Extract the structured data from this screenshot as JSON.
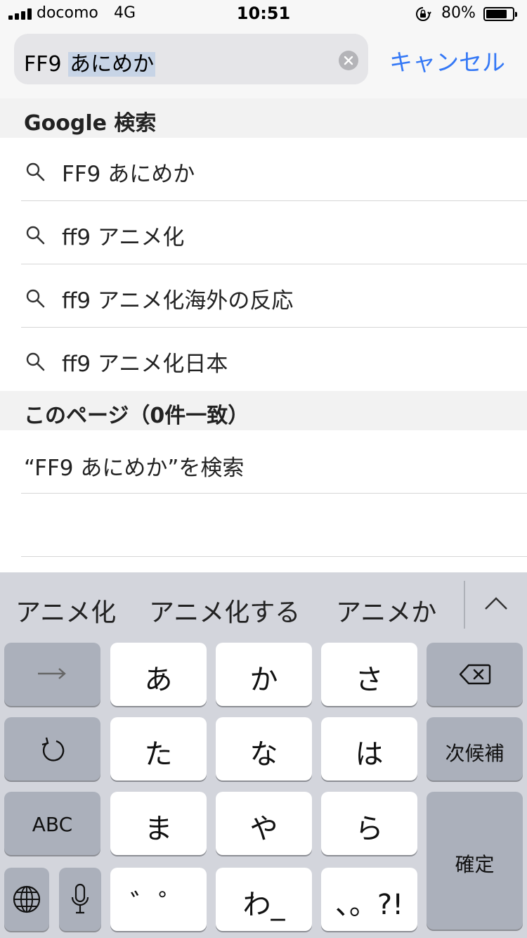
{
  "status_bar": {
    "carrier": "docomo",
    "network": "4G",
    "time": "10:51",
    "battery_percent": "80%",
    "battery_level": 0.8
  },
  "search": {
    "query_prefix": "FF9 ",
    "query_marked": "あにめか",
    "cancel_label": "キャンセル"
  },
  "google_section": {
    "title": "Google 検索",
    "suggestions": [
      "FF9 あにめか",
      "ff9 アニメ化",
      "ff9 アニメ化海外の反応",
      "ff9 アニメ化日本"
    ]
  },
  "page_section": {
    "title": "このページ（0件一致）",
    "find_label": "“FF9 あにめか”を検索"
  },
  "candidates": [
    "アニメ化",
    "アニメ化する",
    "アニメか"
  ],
  "keyboard": {
    "rows": [
      [
        "あ",
        "か",
        "さ"
      ],
      [
        "た",
        "な",
        "は"
      ],
      [
        "ま",
        "や",
        "ら"
      ],
      [
        "゛゜",
        "わ_",
        "、。?!"
      ]
    ],
    "next_candidate": "次候補",
    "abc": "ABC",
    "confirm": "確定"
  },
  "colors": {
    "accent": "#3478f6",
    "keyboard_bg": "#d3d5dc",
    "dark_key": "#abb0bb",
    "section_bg": "#f2f2f2"
  },
  "icons": [
    "search-icon",
    "clear-icon",
    "chevron-up-icon",
    "arrow-right-icon",
    "backspace-icon",
    "undo-icon",
    "globe-icon",
    "microphone-icon",
    "orientation-lock-icon"
  ]
}
